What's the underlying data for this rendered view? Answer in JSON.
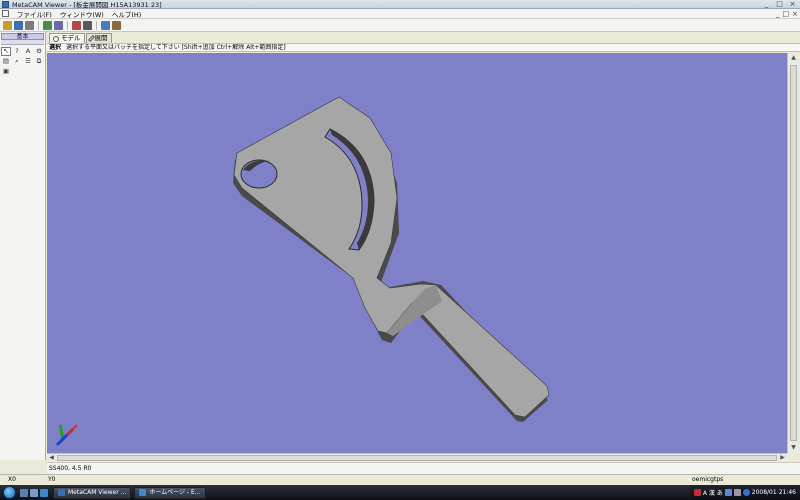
{
  "window": {
    "title": "MetaCAM Viewer - [板金展開図   H15A13931 23]",
    "controls": [
      "_",
      "□",
      "×"
    ]
  },
  "menu": {
    "items": [
      "ファイル(F)",
      "ウィンドウ(W)",
      "ヘルプ(H)"
    ],
    "mdi_controls": [
      "_",
      "□",
      "×"
    ]
  },
  "toolbar": {
    "icons": [
      {
        "name": "open-icon",
        "color": "#c99b2e"
      },
      {
        "name": "save-icon",
        "color": "#3a6fb0"
      },
      {
        "name": "print-icon",
        "color": "#7b7b7b"
      },
      {
        "name": "preview-icon",
        "color": "#4b8b4b"
      },
      {
        "name": "copy-icon",
        "color": "#6a6aa8"
      },
      {
        "name": "paste-icon",
        "color": "#b04a4a"
      },
      {
        "name": "zoom-icon",
        "color": "#5a5a5a"
      },
      {
        "name": "select-icon",
        "color": "#4a7ac0"
      },
      {
        "name": "measure-icon",
        "color": "#8a6a3a"
      }
    ]
  },
  "left_panel": {
    "header": "基本",
    "sub": "−−",
    "tools": [
      "↖",
      "?",
      "A",
      "⚙",
      "▤",
      "⌕",
      "☰",
      "⧉",
      "▣"
    ]
  },
  "tabs": [
    {
      "label": "モデル",
      "active": true
    },
    {
      "label": "展開",
      "active": false
    }
  ],
  "status_line": {
    "mode": "選択",
    "hint": "選択する平面又はパッチを指定して下さい [Shift+追加 Ctrl+解除 Alt+範囲指定]"
  },
  "viewport": {
    "background": "#7e80c8",
    "part_color": "#a6a6a6",
    "axis_colors": {
      "x": "#d03030",
      "y": "#20a020",
      "z": "#2040d0"
    }
  },
  "material": "SS400, 4.5 R0",
  "coords": {
    "x": "X0",
    "y": "Y0",
    "right": "oemicgtps"
  },
  "taskbar": {
    "tasks": [
      {
        "label": "MetaCAM Viewer ...",
        "color": "#3a6fb0"
      },
      {
        "label": "ホームページ - E...",
        "color": "#3a8ad0"
      }
    ],
    "tray": {
      "ime": "A 漢 あ",
      "date": "2008/01",
      "time": "21:46"
    }
  }
}
